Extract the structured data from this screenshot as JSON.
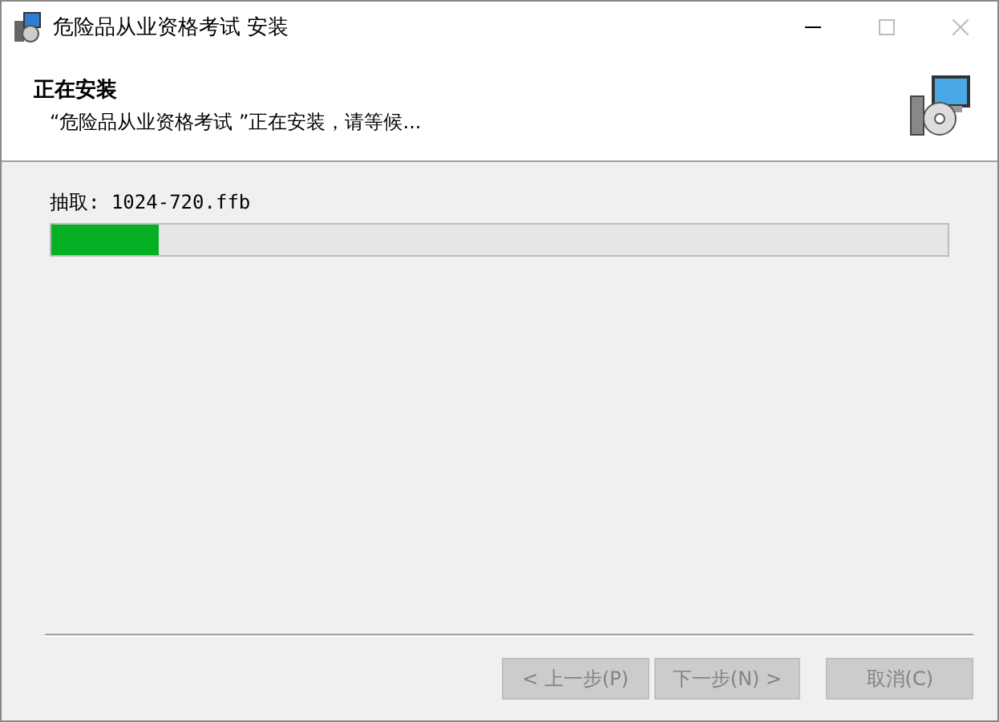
{
  "window": {
    "title": "危险品从业资格考试 安装"
  },
  "header": {
    "title": "正在安装",
    "subtitle": "“危险品从业资格考试 ”正在安装，请等候..."
  },
  "progress": {
    "label": "抽取: 1024-720.ffb",
    "level": 0.12
  },
  "buttons": [
    {
      "label": "< 上一步(P)",
      "disabled": true
    },
    {
      "label": "下一步(N) >",
      "disabled": true
    },
    {
      "label": "取消(C)",
      "disabled": true
    }
  ]
}
